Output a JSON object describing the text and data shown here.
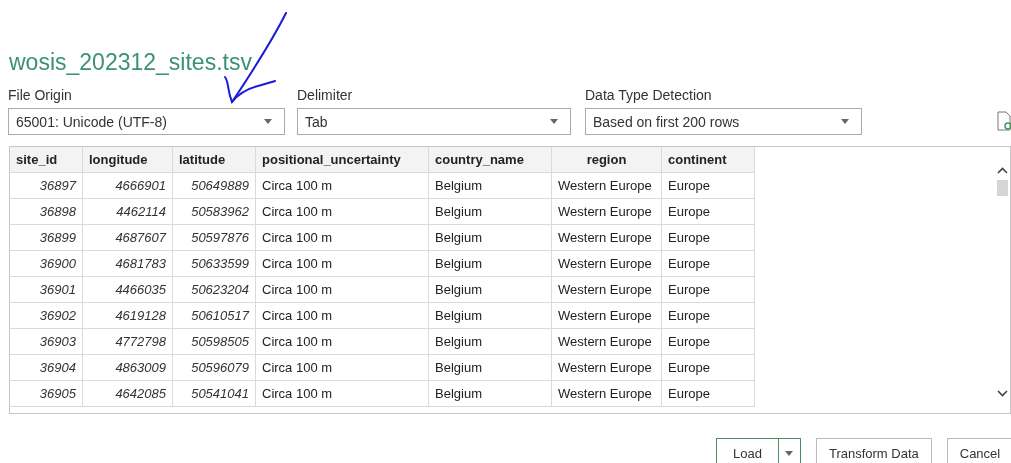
{
  "title": "wosis_202312_sites.tsv",
  "options": [
    {
      "label": "File Origin",
      "value": "65001: Unicode (UTF-8)"
    },
    {
      "label": "Delimiter",
      "value": "Tab"
    },
    {
      "label": "Data Type Detection",
      "value": "Based on first 200 rows"
    }
  ],
  "table": {
    "columns": [
      {
        "name": "site_id",
        "kind": "number"
      },
      {
        "name": "longitude",
        "kind": "number"
      },
      {
        "name": "latitude",
        "kind": "number"
      },
      {
        "name": "positional_uncertainty",
        "kind": "text"
      },
      {
        "name": "country_name",
        "kind": "text"
      },
      {
        "name": "region",
        "kind": "text"
      },
      {
        "name": "continent",
        "kind": "text"
      }
    ],
    "rows": [
      [
        "36897",
        "4666901",
        "50649889",
        "Circa 100 m",
        "Belgium",
        "Western Europe",
        "Europe"
      ],
      [
        "36898",
        "4462114",
        "50583962",
        "Circa 100 m",
        "Belgium",
        "Western Europe",
        "Europe"
      ],
      [
        "36899",
        "4687607",
        "50597876",
        "Circa 100 m",
        "Belgium",
        "Western Europe",
        "Europe"
      ],
      [
        "36900",
        "4681783",
        "50633599",
        "Circa 100 m",
        "Belgium",
        "Western Europe",
        "Europe"
      ],
      [
        "36901",
        "4466035",
        "50623204",
        "Circa 100 m",
        "Belgium",
        "Western Europe",
        "Europe"
      ],
      [
        "36902",
        "4619128",
        "50610517",
        "Circa 100 m",
        "Belgium",
        "Western Europe",
        "Europe"
      ],
      [
        "36903",
        "4772798",
        "50598505",
        "Circa 100 m",
        "Belgium",
        "Western Europe",
        "Europe"
      ],
      [
        "36904",
        "4863009",
        "50596079",
        "Circa 100 m",
        "Belgium",
        "Western Europe",
        "Europe"
      ],
      [
        "36905",
        "4642085",
        "50541041",
        "Circa 100 m",
        "Belgium",
        "Western Europe",
        "Europe"
      ]
    ]
  },
  "buttons": [
    {
      "label": "Load",
      "kind": "split"
    },
    {
      "label": "Transform Data",
      "kind": "plain"
    },
    {
      "label": "Cancel",
      "kind": "plain"
    }
  ]
}
